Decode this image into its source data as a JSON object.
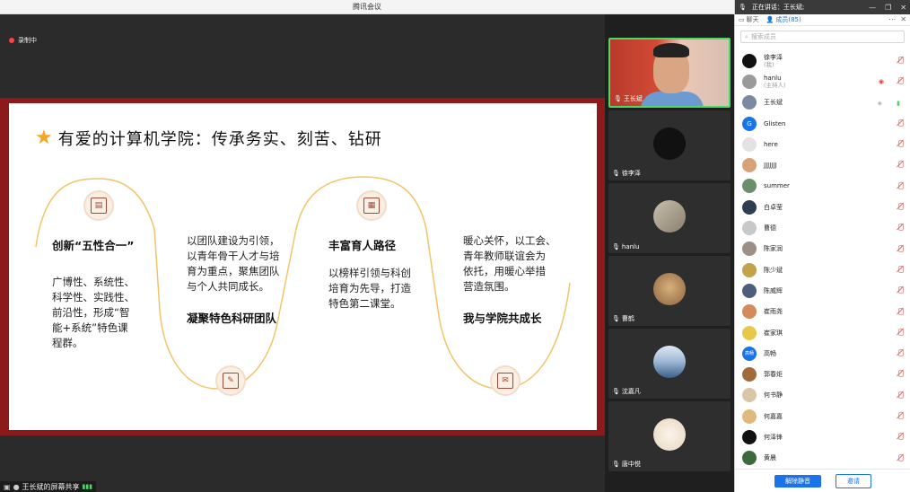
{
  "window": {
    "title": "腾讯会议"
  },
  "stage": {
    "recording_label": "录制中",
    "share_label": "王长斌的屏幕共享"
  },
  "slide": {
    "title": "有爱的计算机学院：传承务实、刻苦、钻研",
    "col1": {
      "heading": "创新“五性合一”",
      "body": [
        "广博性、系统性、",
        "科学性、实践性、",
        "前沿性，形成“智",
        "能+系统”特色课",
        "程群。"
      ]
    },
    "col2": {
      "body": [
        "以团队建设为引领，",
        "以青年骨干人才与培",
        "育为重点，聚焦团队",
        "与个人共同成长。"
      ],
      "heading": "凝聚特色科研团队"
    },
    "col3": {
      "heading": "丰富育人路径",
      "body": [
        "以榜样引领与科创",
        "培育为先导，打造",
        "特色第二课堂。"
      ]
    },
    "col4": {
      "body": [
        "暖心关怀，以工会、",
        "青年教师联谊会为",
        "依托，用暖心举措",
        "营造氛围。"
      ],
      "heading": "我与学院共成长"
    }
  },
  "video_tiles": [
    {
      "name": "王长斌",
      "active": true
    },
    {
      "name": "徐李泽",
      "avatar_color": "#111111"
    },
    {
      "name": "hanlu",
      "avatar_color": "#d8d0c4"
    },
    {
      "name": "曹鹤",
      "avatar_color": "#b98c5a"
    },
    {
      "name": "沈嘉凡",
      "avatar_color": "#6f8fb5"
    },
    {
      "name": "唐中悦",
      "avatar_color": "#f1e6d6"
    }
  ],
  "panel": {
    "speaking_prefix": "正在讲话：",
    "speaking_name": "王长斌;",
    "tab_chat": "聊天",
    "tab_members": "成员(85)",
    "search_placeholder": "搜索成员",
    "members": [
      {
        "name": "徐李泽",
        "sub": "(我)",
        "color": "#111111"
      },
      {
        "name": "hanlu",
        "sub": "(主持人)",
        "color": "#9a9a9a"
      },
      {
        "name": "王长斌",
        "sub": "",
        "color": "#7a8aa3"
      },
      {
        "name": "Glisten",
        "sub": "",
        "color": "#1a73e8",
        "letter": "G"
      },
      {
        "name": "here",
        "sub": "",
        "color": "#e3e3e3"
      },
      {
        "name": "JJJJJJJ",
        "sub": "",
        "color": "#d7a27a"
      },
      {
        "name": "summer",
        "sub": "",
        "color": "#6b8e6b"
      },
      {
        "name": "白卓莹",
        "sub": "",
        "color": "#2d3e50"
      },
      {
        "name": "曹德",
        "sub": "",
        "color": "#c8c8c8"
      },
      {
        "name": "陈家润",
        "sub": "",
        "color": "#9d8f86"
      },
      {
        "name": "陈少斌",
        "sub": "",
        "color": "#c2a24b"
      },
      {
        "name": "陈威辉",
        "sub": "",
        "color": "#4c5f7a"
      },
      {
        "name": "崔雨尧",
        "sub": "",
        "color": "#d58a5c"
      },
      {
        "name": "崔家琪",
        "sub": "",
        "color": "#e7c84b"
      },
      {
        "name": "高畅",
        "sub": "",
        "color": "#1a73e8",
        "letter": "高畅"
      },
      {
        "name": "郭春炬",
        "sub": "",
        "color": "#a16a3d"
      },
      {
        "name": "何书静",
        "sub": "",
        "color": "#d9c5a8"
      },
      {
        "name": "何嘉嘉",
        "sub": "",
        "color": "#e1b87f"
      },
      {
        "name": "何泽锋",
        "sub": "",
        "color": "#111111"
      },
      {
        "name": "黄晨",
        "sub": "",
        "color": "#3d6a3d"
      }
    ],
    "unmute_button": "解除静音",
    "invite_button": "邀请"
  }
}
